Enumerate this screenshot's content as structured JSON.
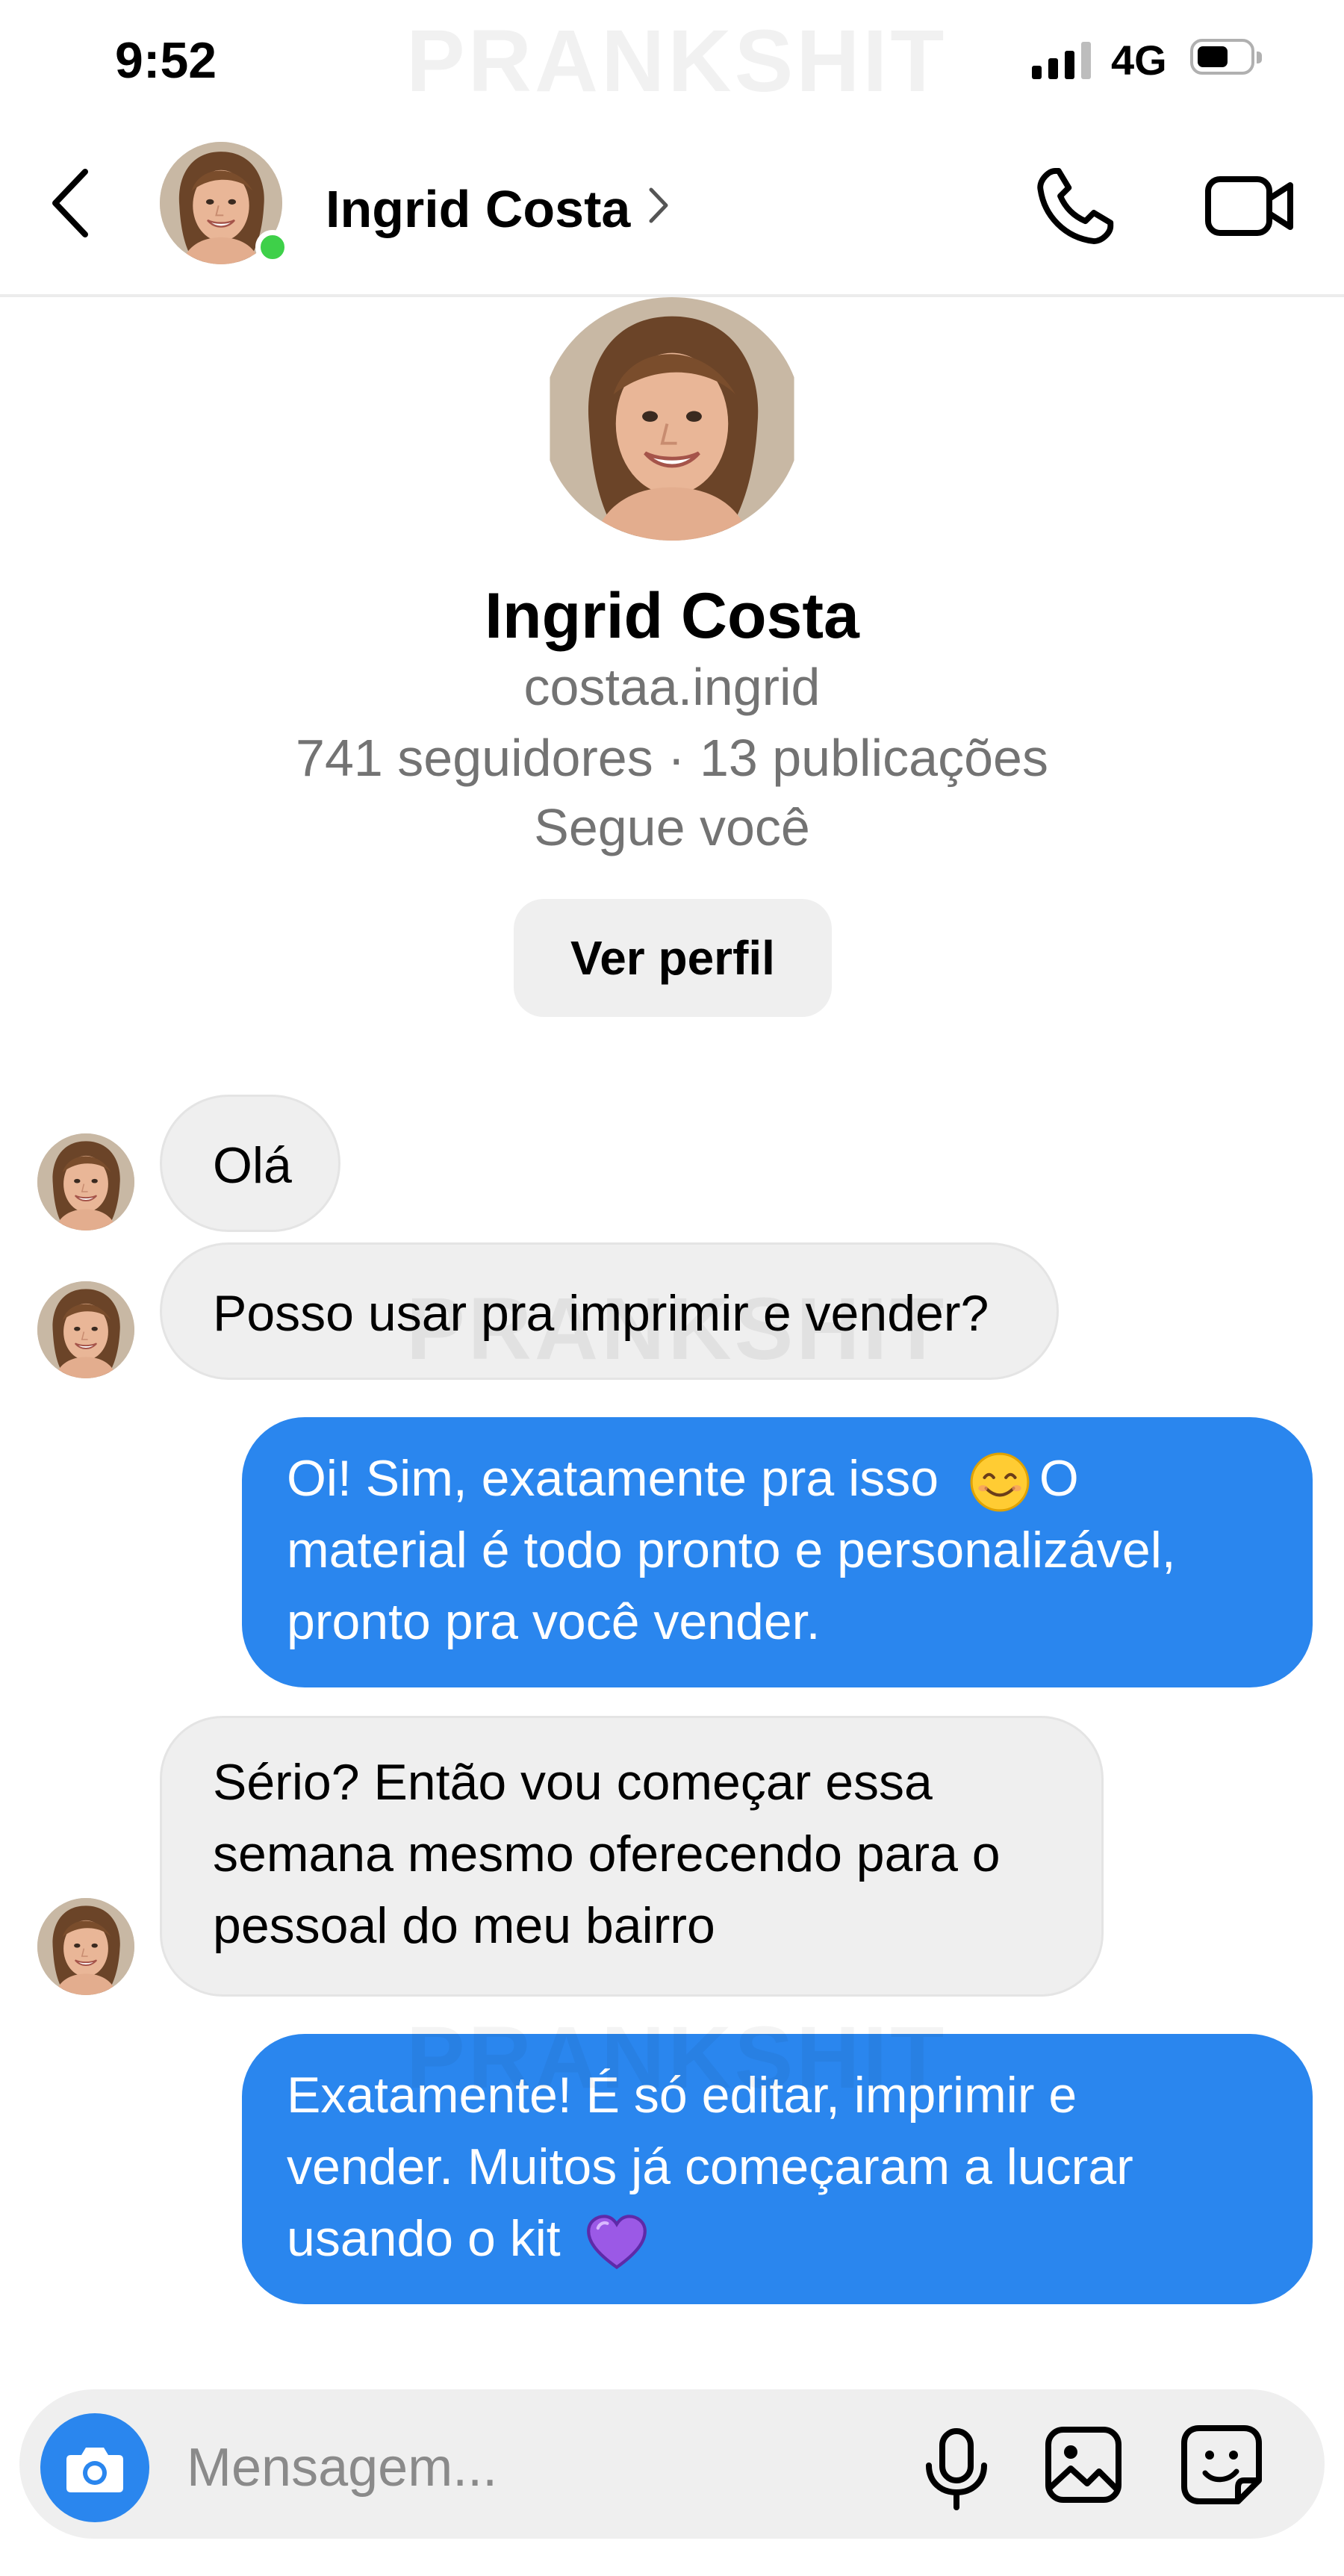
{
  "status_bar": {
    "time": "9:52",
    "network": "4G",
    "watermark": "PRANKSHIT"
  },
  "header": {
    "name": "Ingrid Costa",
    "online": true
  },
  "profile": {
    "name": "Ingrid Costa",
    "username": "costaa.ingrid",
    "stats": "741 seguidores · 13 publicações",
    "follow_status": "Segue você",
    "view_profile_label": "Ver perfil"
  },
  "messages": [
    {
      "direction": "in",
      "text": "Olá"
    },
    {
      "direction": "in",
      "text": "Posso usar pra imprimir e vender?"
    },
    {
      "direction": "out",
      "lines": [
        "Oi! Sim, exatamente pra isso",
        "material é todo pronto e personalizável,",
        "pronto pra você vender."
      ],
      "emoji": "smiling-face",
      "after_emoji": "O"
    },
    {
      "direction": "in",
      "lines": [
        "Sério? Então vou começar essa",
        "semana mesmo oferecendo para o",
        "pessoal do meu bairro"
      ]
    },
    {
      "direction": "out",
      "lines": [
        "Exatamente! É só editar, imprimir e",
        "vender. Muitos já começaram a lucrar",
        "usando o kit"
      ],
      "emoji": "purple-heart"
    }
  ],
  "composer": {
    "placeholder": "Mensagem..."
  },
  "colors": {
    "outgoing_bubble": "#2a86ee",
    "incoming_bubble": "#efefef",
    "online_dot": "#3ed049",
    "muted_text": "#737373"
  },
  "icons": [
    "back-arrow",
    "chevron-right",
    "phone",
    "video-camera",
    "camera",
    "microphone",
    "gallery",
    "sticker",
    "smiling-face",
    "purple-heart"
  ]
}
